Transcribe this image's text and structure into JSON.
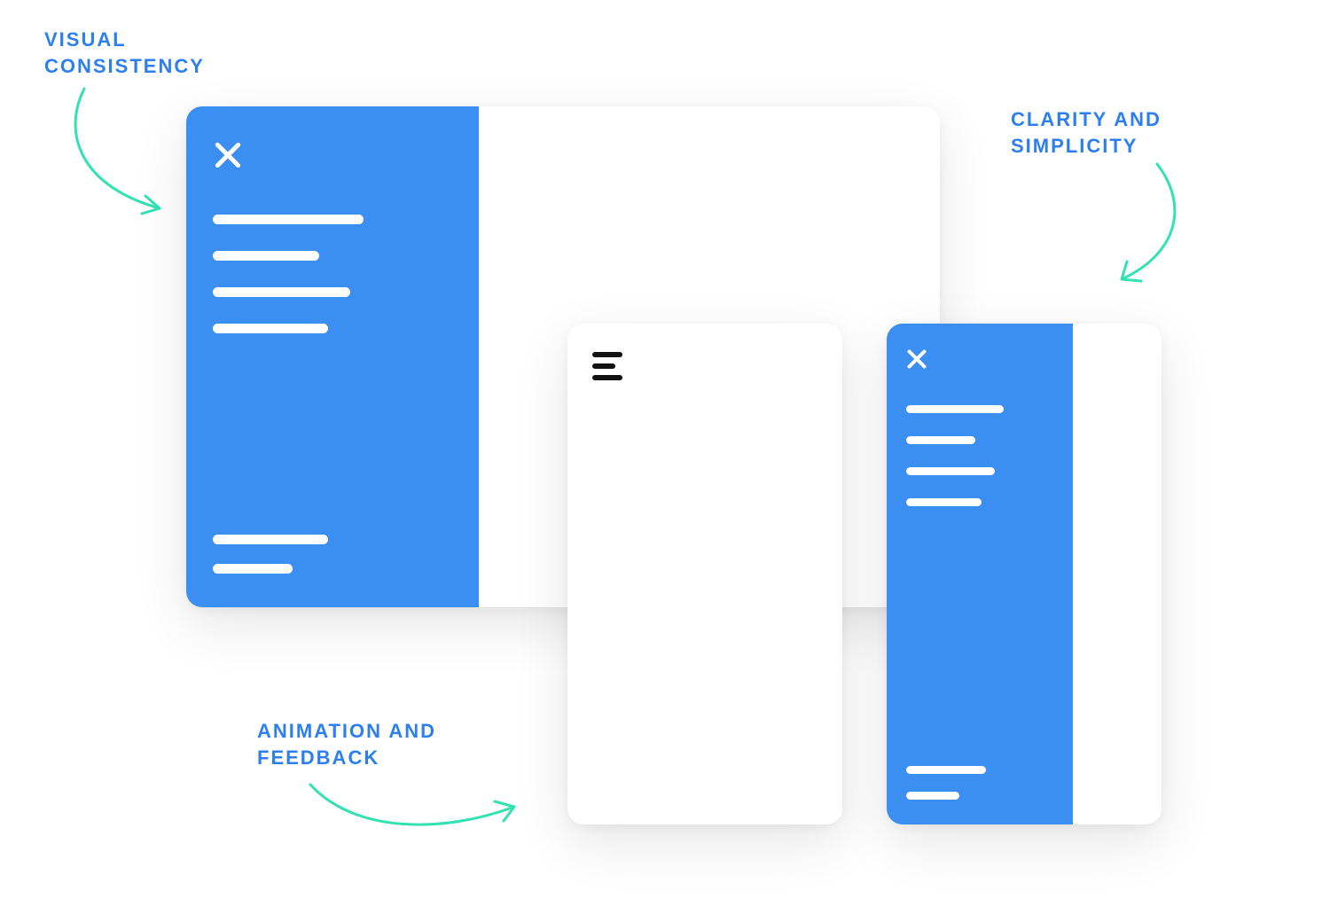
{
  "labels": {
    "visual_consistency": "VISUAL\nCONSISTENCY",
    "clarity_simplicity": "CLARITY AND\nSIMPLICITY",
    "animation_feedback": "ANIMATION AND\nFEEDBACK"
  },
  "icons": {
    "close": "close-icon",
    "hamburger": "hamburger-icon"
  },
  "colors": {
    "primary": "#3b8ef2",
    "label": "#2d7ff0",
    "arrow": "#32e2b3"
  },
  "mockups": {
    "desktop": {
      "sidebar_open": true,
      "top_items_count": 4,
      "bottom_items_count": 2
    },
    "phone_closed": {
      "sidebar_open": false
    },
    "phone_open": {
      "sidebar_open": true,
      "top_items_count": 4,
      "bottom_items_count": 2
    }
  }
}
